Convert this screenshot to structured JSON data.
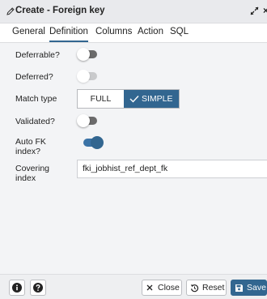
{
  "dialog": {
    "title": "Create - Foreign key",
    "close_glyph": "×"
  },
  "tabs": [
    {
      "label": "General",
      "active": false
    },
    {
      "label": "Definition",
      "active": true
    },
    {
      "label": "Columns",
      "active": false
    },
    {
      "label": "Action",
      "active": false
    },
    {
      "label": "SQL",
      "active": false
    }
  ],
  "form": {
    "deferrable": {
      "label": "Deferrable?",
      "value": false
    },
    "deferred": {
      "label": "Deferred?",
      "value": false,
      "disabled": true
    },
    "match_type": {
      "label": "Match type",
      "options": [
        "FULL",
        "SIMPLE"
      ],
      "selected": "SIMPLE"
    },
    "validated": {
      "label": "Validated?",
      "value": false
    },
    "auto_fk_index": {
      "label_line1": "Auto FK",
      "label_line2": "index?",
      "value": true
    },
    "covering_index": {
      "label_line1": "Covering",
      "label_line2": "index",
      "value": "fki_jobhist_ref_dept_fk"
    }
  },
  "footer": {
    "info_icon": "info-icon",
    "help_icon": "help-icon",
    "close_label": "Close",
    "reset_label": "Reset",
    "save_label": "Save"
  },
  "colors": {
    "accent": "#326690",
    "toggle_off": "#6b6b6b",
    "content_bg": "#f3f4f6"
  }
}
